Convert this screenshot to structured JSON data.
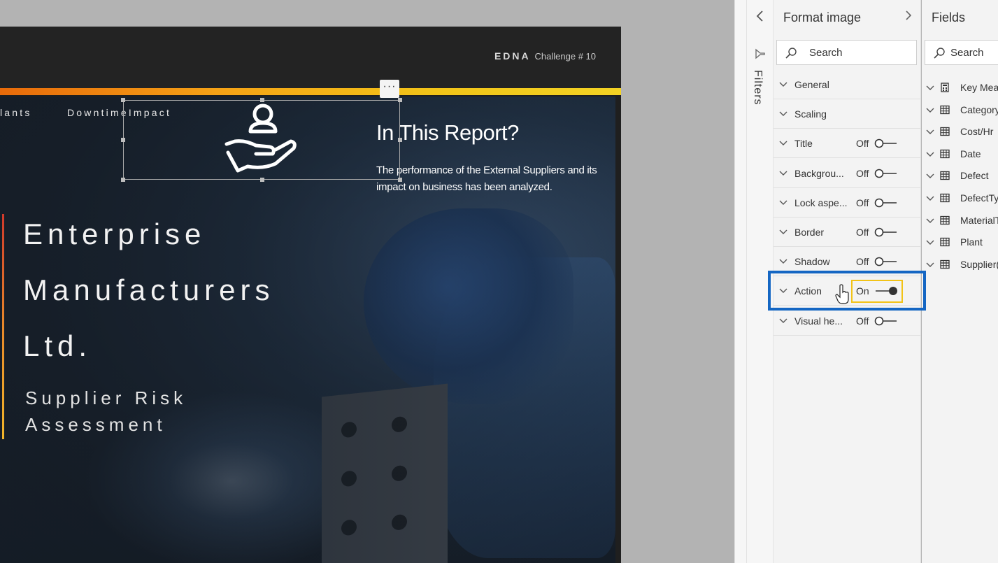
{
  "report": {
    "brand_bold": "EDNA",
    "brand_rest": "Challenge # 10",
    "nav_left": "lants",
    "nav_right": "DowntimeImpact",
    "title_lines": [
      "Enterprise",
      "Manufacturers",
      "Ltd."
    ],
    "subtitle_lines": [
      "Supplier Risk",
      "Assessment"
    ],
    "heading": "In This Report?",
    "paragraph": "The performance of the External Suppliers and its impact on business has been analyzed.",
    "more_options": "···",
    "icon": "person-hand-icon",
    "accent_colors": [
      "#e86a0a",
      "#f5a216",
      "#f2c418",
      "#f3d324"
    ]
  },
  "filters": {
    "label": "Filters",
    "collapse_icon": "chevron-left-icon",
    "funnel_icon": "funnel-icon"
  },
  "format": {
    "title": "Format image",
    "expand_icon": "chevron-right-icon",
    "search_placeholder": "Search",
    "cards": [
      {
        "label": "General",
        "state": "",
        "on": null
      },
      {
        "label": "Scaling",
        "state": "",
        "on": null
      },
      {
        "label": "Title",
        "state": "Off",
        "on": false
      },
      {
        "label": "Backgrou...",
        "state": "Off",
        "on": false
      },
      {
        "label": "Lock aspe...",
        "state": "Off",
        "on": false
      },
      {
        "label": "Border",
        "state": "Off",
        "on": false
      },
      {
        "label": "Shadow",
        "state": "Off",
        "on": false
      },
      {
        "label": "Action",
        "state": "On",
        "on": true
      },
      {
        "label": "Visual he...",
        "state": "Off",
        "on": false
      }
    ],
    "highlight_color": "#1466c3",
    "toggle_highlight_color": "#f2c318"
  },
  "fields": {
    "title": "Fields",
    "search_placeholder": "Search",
    "items": [
      {
        "name": "Key Mea",
        "icon": "calculator-icon"
      },
      {
        "name": "Category",
        "icon": "table-icon"
      },
      {
        "name": "Cost/Hr",
        "icon": "table-icon"
      },
      {
        "name": "Date",
        "icon": "table-icon"
      },
      {
        "name": "Defect",
        "icon": "table-icon"
      },
      {
        "name": "DefectTy",
        "icon": "table-icon"
      },
      {
        "name": "MaterialT",
        "icon": "table-icon"
      },
      {
        "name": "Plant",
        "icon": "table-icon"
      },
      {
        "name": "Supplier(",
        "icon": "table-icon"
      }
    ]
  }
}
